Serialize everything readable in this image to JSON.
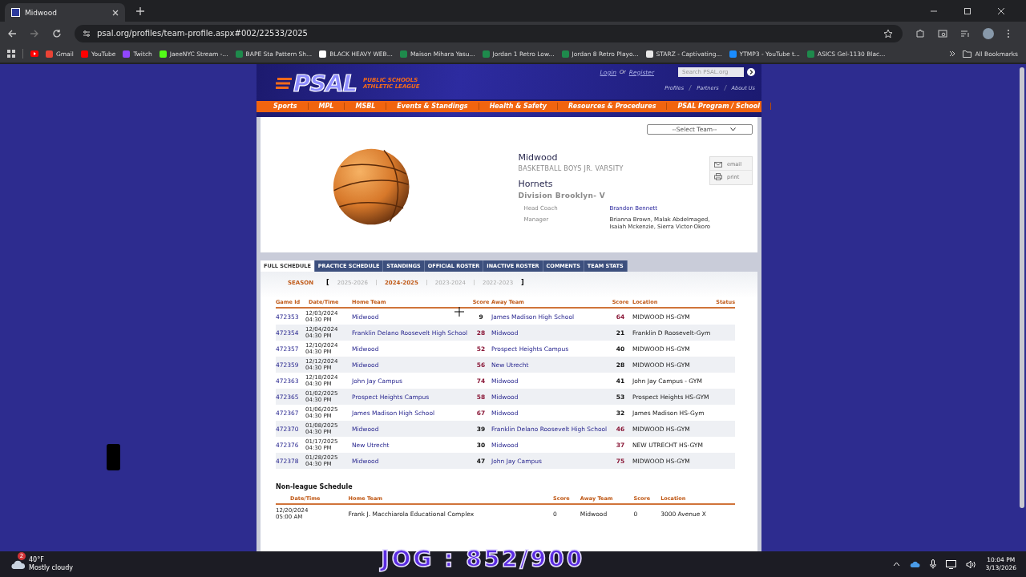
{
  "browser": {
    "tab_title": "Midwood",
    "url": "psal.org/profiles/team-profile.aspx#002/22533/2025",
    "bookmarks": [
      {
        "label": "Gmail",
        "color": "#ea4335"
      },
      {
        "label": "YouTube",
        "color": "#ff0000"
      },
      {
        "label": "Twitch",
        "color": "#9146ff"
      },
      {
        "label": "JaeeNYC Stream -...",
        "color": "#53fc18"
      },
      {
        "label": "BAPE Sta Pattern Sh...",
        "color": "#1e8a4c"
      },
      {
        "label": "BLACK HEAVY WEB...",
        "color": "#ffffff"
      },
      {
        "label": "Maison Mihara Yasu...",
        "color": "#1e8a4c"
      },
      {
        "label": "Jordan 1 Retro Low...",
        "color": "#1e8a4c"
      },
      {
        "label": "Jordan 8 Retro Playo...",
        "color": "#1e8a4c"
      },
      {
        "label": "STARZ - Captivating...",
        "color": "#e8e8e8"
      },
      {
        "label": "YTMP3 - YouTube t...",
        "color": "#1a8cff"
      },
      {
        "label": "ASICS Gel-1130 Blac...",
        "color": "#1e8a4c"
      }
    ],
    "all_bookmarks": "All Bookmarks"
  },
  "site": {
    "logo": "PSAL",
    "logo_sub": [
      "PUBLIC SCHOOLS",
      "ATHLETIC LEAGUE"
    ],
    "login": "Login",
    "or": "Or",
    "register": "Register",
    "search_placeholder": "Search PSAL.org",
    "util_links": [
      "Profiles",
      "Partners",
      "About Us"
    ],
    "nav": [
      "Sports",
      "MPL",
      "MSBL",
      "Events & Standings",
      "Health & Safety",
      "Resources & Procedures",
      "PSAL Program / School"
    ]
  },
  "team": {
    "select_placeholder": "--Select Team--",
    "name": "Midwood",
    "sport": "BASKETBALL BOYS JR. VARSITY",
    "mascot": "Hornets",
    "division": "Division  Brooklyn- V",
    "staff": [
      {
        "label": "Head Coach",
        "value": "Brandon Bennett",
        "link": true
      },
      {
        "label": "Manager",
        "value": "Brianna Brown, Malak Abdelmaged, Isaiah Mckenzie, Sierra Victor-Okoro",
        "link": false
      }
    ],
    "actions": [
      "email",
      "print"
    ]
  },
  "tabs": [
    {
      "label": "FULL SCHEDULE",
      "selected": true
    },
    {
      "label": "PRACTICE SCHEDULE",
      "selected": false
    },
    {
      "label": "STANDINGS",
      "selected": false
    },
    {
      "label": "OFFICIAL ROSTER",
      "selected": false
    },
    {
      "label": "INACTIVE ROSTER",
      "selected": false
    },
    {
      "label": "COMMENTS",
      "selected": false
    },
    {
      "label": "TEAM STATS",
      "selected": false
    }
  ],
  "season": {
    "label": "SEASON",
    "open": "[",
    "close": "]",
    "options": [
      {
        "label": "2025-2026",
        "selected": false
      },
      {
        "label": "2024-2025",
        "selected": true
      },
      {
        "label": "2023-2024",
        "selected": false
      },
      {
        "label": "2022-2023",
        "selected": false
      }
    ]
  },
  "schedule": {
    "columns": [
      "Game Id",
      "Date/Time",
      "Home Team",
      "Score",
      "Away Team",
      "Score",
      "Location",
      "Status"
    ],
    "rows": [
      {
        "id": "472353",
        "date": "12/03/2024",
        "time": "04:30 PM",
        "home": "Midwood",
        "home_score": "9",
        "home_won": false,
        "away": "James Madison High School",
        "away_score": "64",
        "away_won": true,
        "location": "MIDWOOD HS-GYM"
      },
      {
        "id": "472354",
        "date": "12/04/2024",
        "time": "04:30 PM",
        "home": "Franklin Delano Roosevelt High School",
        "home_score": "28",
        "home_won": true,
        "away": "Midwood",
        "away_score": "21",
        "away_won": false,
        "location": "Franklin D Roosevelt-Gym"
      },
      {
        "id": "472357",
        "date": "12/10/2024",
        "time": "04:30 PM",
        "home": "Midwood",
        "home_score": "52",
        "home_won": true,
        "away": "Prospect Heights Campus",
        "away_score": "40",
        "away_won": false,
        "location": "MIDWOOD HS-GYM"
      },
      {
        "id": "472359",
        "date": "12/12/2024",
        "time": "04:30 PM",
        "home": "Midwood",
        "home_score": "56",
        "home_won": true,
        "away": "New Utrecht",
        "away_score": "28",
        "away_won": false,
        "location": "MIDWOOD HS-GYM"
      },
      {
        "id": "472363",
        "date": "12/18/2024",
        "time": "04:30 PM",
        "home": "John Jay Campus",
        "home_score": "74",
        "home_won": true,
        "away": "Midwood",
        "away_score": "41",
        "away_won": false,
        "location": "John Jay Campus - GYM"
      },
      {
        "id": "472365",
        "date": "01/02/2025",
        "time": "04:30 PM",
        "home": "Prospect Heights Campus",
        "home_score": "58",
        "home_won": true,
        "away": "Midwood",
        "away_score": "53",
        "away_won": false,
        "location": "Prospect Heights HS-GYM"
      },
      {
        "id": "472367",
        "date": "01/06/2025",
        "time": "04:30 PM",
        "home": "James Madison High School",
        "home_score": "67",
        "home_won": true,
        "away": "Midwood",
        "away_score": "32",
        "away_won": false,
        "location": "James Madison HS-Gym"
      },
      {
        "id": "472370",
        "date": "01/08/2025",
        "time": "04:30 PM",
        "home": "Midwood",
        "home_score": "39",
        "home_won": false,
        "away": "Franklin Delano Roosevelt High School",
        "away_score": "46",
        "away_won": true,
        "location": "MIDWOOD HS-GYM"
      },
      {
        "id": "472376",
        "date": "01/17/2025",
        "time": "04:30 PM",
        "home": "New Utrecht",
        "home_score": "30",
        "home_won": false,
        "away": "Midwood",
        "away_score": "37",
        "away_won": true,
        "location": "NEW UTRECHT HS-GYM"
      },
      {
        "id": "472378",
        "date": "01/28/2025",
        "time": "04:30 PM",
        "home": "Midwood",
        "home_score": "47",
        "home_won": false,
        "away": "John Jay Campus",
        "away_score": "75",
        "away_won": true,
        "location": "MIDWOOD HS-GYM"
      }
    ]
  },
  "nonleague": {
    "title": "Non-league Schedule",
    "columns": [
      "Date/Time",
      "Home Team",
      "Score",
      "Away Team",
      "Score",
      "Location"
    ],
    "rows": [
      {
        "date": "12/20/2024",
        "time": "05:00 AM",
        "home": "Frank J. Macchiarola Educational Complex",
        "home_score": "0",
        "away": "Midwood",
        "away_score": "0",
        "location": "3000 Avenue X"
      }
    ]
  },
  "overlay": "JOG : 852/900",
  "taskbar": {
    "badge": "2",
    "temp": "40°F",
    "weather": "Mostly cloudy",
    "time": "10:04 PM",
    "date": "3/13/2026"
  }
}
